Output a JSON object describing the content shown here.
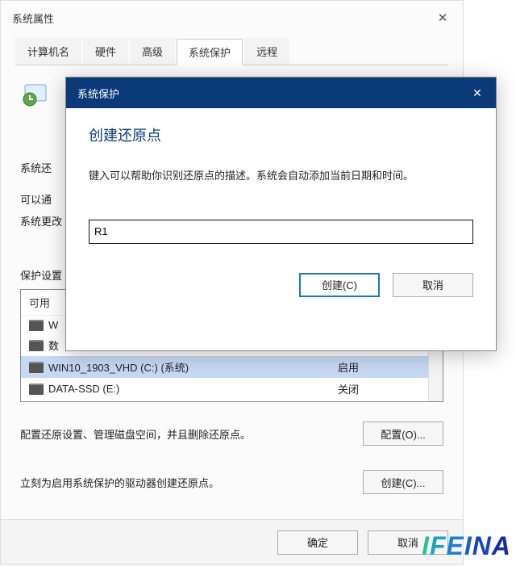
{
  "outer": {
    "title": "系统属性",
    "tabs": [
      "计算机名",
      "硬件",
      "高级",
      "系统保护",
      "远程"
    ],
    "active_tab_index": 3,
    "close_glyph": "✕"
  },
  "body": {
    "restore_label_prefix": "系统还",
    "desc1_prefix": "可以通",
    "desc1_suffix": "系统更改",
    "protection_settings_label": "保护设置",
    "table_head": "可用",
    "rows": [
      {
        "name": "W",
        "status": ""
      },
      {
        "name": "数",
        "status": ""
      },
      {
        "name": "WIN10_1903_VHD (C:) (系统)",
        "status": "启用"
      },
      {
        "name": "DATA-SSD (E:)",
        "status": "关闭"
      }
    ],
    "configure_desc": "配置还原设置、管理磁盘空间，并且删除还原点。",
    "configure_btn": "配置(O)...",
    "create_desc": "立刻为启用系统保护的驱动器创建还原点。",
    "create_btn": "创建(C)...",
    "ok_btn": "确定",
    "cancel_btn": "取消"
  },
  "modal": {
    "title": "系统保护",
    "heading": "创建还原点",
    "description": "键入可以帮助你识别还原点的描述。系统会自动添加当前日期和时间。",
    "input_value": "R1",
    "create_btn": "创建(C)",
    "cancel_btn": "取消",
    "close_glyph": "✕"
  },
  "watermark": "IFEINA"
}
